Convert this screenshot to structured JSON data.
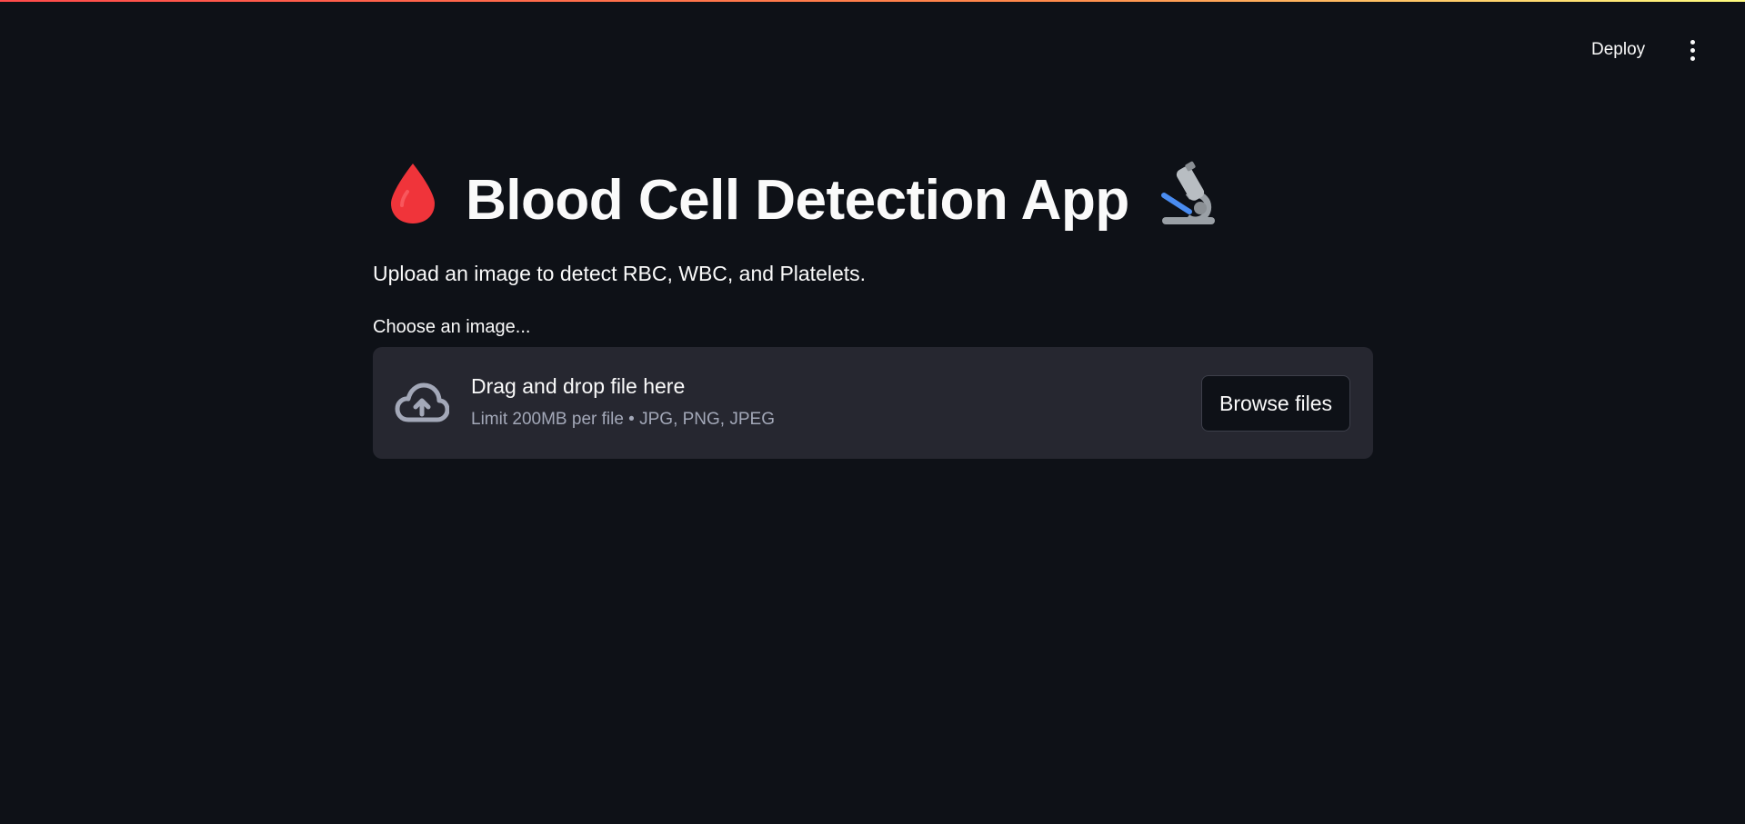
{
  "header": {
    "deploy_label": "Deploy",
    "menu_icon": "vertical-dots-icon"
  },
  "main": {
    "title": "Blood Cell Detection App",
    "title_icons": [
      "blood-drop-icon",
      "microscope-icon"
    ],
    "subtitle": "Upload an image to detect RBC, WBC, and Platelets.",
    "uploader": {
      "label": "Choose an image...",
      "drop_text": "Drag and drop file here",
      "limit_text": "Limit 200MB per file • JPG, PNG, JPEG",
      "browse_label": "Browse files",
      "icon": "cloud-upload-icon"
    }
  },
  "colors": {
    "background": "#0e1117",
    "dropzone": "#262730",
    "text": "#fafafa",
    "muted": "#a3a8b8",
    "accent": "#ff4b4b"
  }
}
